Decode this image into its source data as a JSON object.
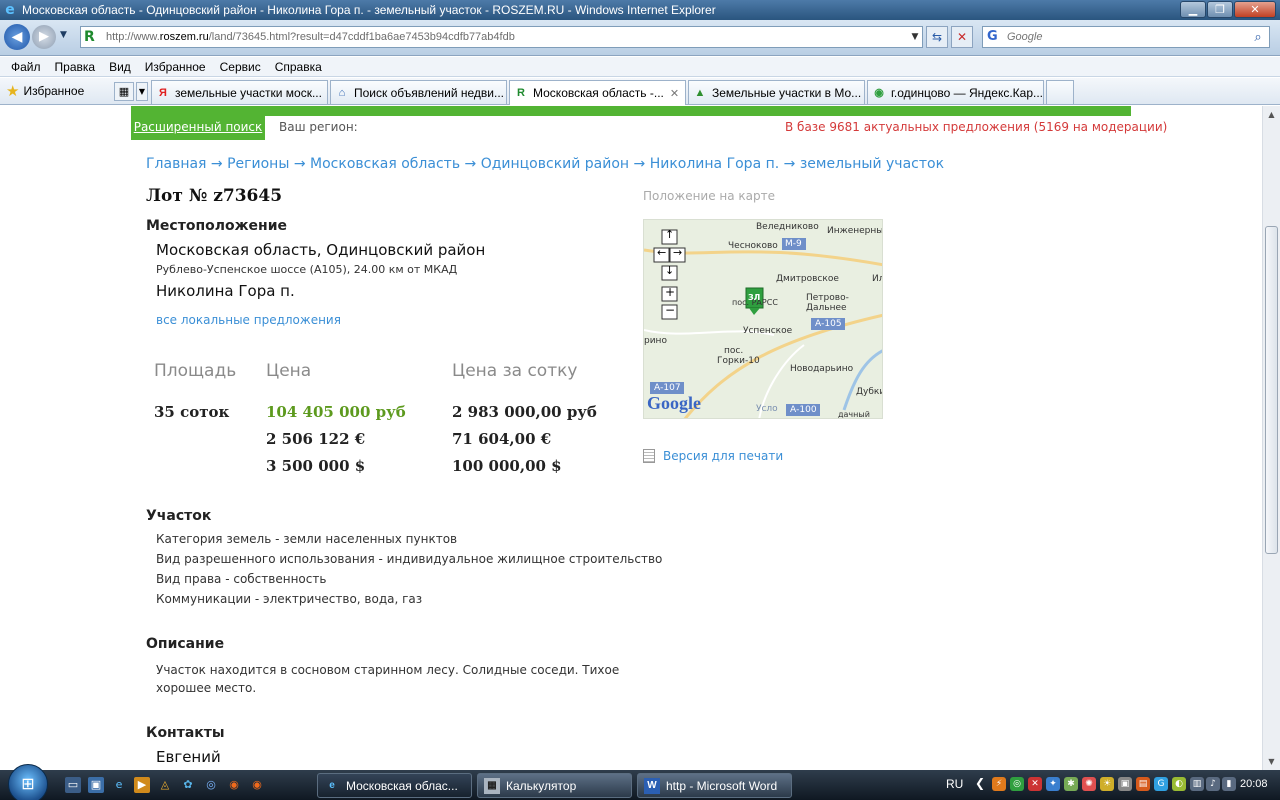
{
  "window": {
    "title": "Московская область - Одинцовский район - Николина Гора п. - земельный участок - ROSZEM.RU - Windows Internet Explorer"
  },
  "address": {
    "url_prefix": "http://www.",
    "url_domain": "roszem.ru",
    "url_rest": "/land/73645.html?result=d47cddf1ba6ae7453b94cdfb77ab4fdb",
    "search_placeholder": "Google"
  },
  "menu": [
    "Файл",
    "Правка",
    "Вид",
    "Избранное",
    "Сервис",
    "Справка"
  ],
  "favorites_label": "Избранное",
  "tabs": [
    {
      "label": "земельные участки моск...",
      "icon": "yandex-icon"
    },
    {
      "label": "Поиск объявлений недви...",
      "icon": "home-icon"
    },
    {
      "label": "Московская область -...",
      "icon": "roszem-icon",
      "active": true
    },
    {
      "label": "Земельные участки в Мо...",
      "icon": "land-icon"
    },
    {
      "label": "г.одинцово — Яндекс.Кар...",
      "icon": "yandex-maps-icon"
    }
  ],
  "page": {
    "advanced_search": "Расширенный поиск",
    "region_label": "Ваш регион:",
    "db_count": "В базе 9681 актуальных предложения (5169 на модерации)",
    "breadcrumb": "Главная → Регионы → Московская область → Одинцовский район → Николина Гора п. → земельный участок",
    "lot_title": "Лот № z73645",
    "location": {
      "heading": "Местоположение",
      "region": "Московская область, Одинцовский район",
      "road": "Рублево-Успенское шоссе (А105), 24.00 км от МКАД",
      "place": "Николина Гора п.",
      "local_link": "все локальные предложения"
    },
    "price": {
      "area_h": "Площадь",
      "price_h": "Цена",
      "per_h": "Цена за сотку",
      "area": "35 соток",
      "rub": "104 405 000 руб",
      "eur": "2 506 122 €",
      "usd": "3 500 000 $",
      "per_rub": "2 983 000,00 руб",
      "per_eur": "71 604,00 €",
      "per_usd": "100 000,00 $"
    },
    "plot": {
      "heading": "Участок",
      "rows": [
        "Категория земель - земли населенных пунктов",
        "Вид разрешенного использования - индивидуальное жилищное строительство",
        "Вид права - собственность",
        "Коммуникации - электричество, вода, газ"
      ]
    },
    "description": {
      "heading": "Описание",
      "text": "Участок находится в сосновом старинном лесу. Солидные соседи. Тихое хорошее место."
    },
    "contacts": {
      "heading": "Контакты",
      "name": "Евгений"
    },
    "map": {
      "label": "Положение на карте",
      "places": [
        "Веледниково",
        "Инженерный",
        "Чесноково",
        "М-9",
        "Дмитровское",
        "Ил",
        "Петрово-Дальнее",
        "пос. РАРСС",
        "Успенское",
        "А-105",
        "рино",
        "пос.",
        "Горки-10",
        "Новодарьино",
        "Дубки",
        "А-107",
        "Усло",
        "А-100",
        "дачный пос"
      ],
      "marker": "ЗЛ",
      "google": "Google"
    },
    "print_link": "Версия для печати"
  },
  "taskbar": {
    "buttons": [
      {
        "label": "Московская облас...",
        "icon": "ie-icon",
        "active": true
      },
      {
        "label": "Калькулятор",
        "icon": "calculator-icon"
      },
      {
        "label": "http - Microsoft Word",
        "icon": "word-icon"
      }
    ],
    "lang": "RU",
    "clock": "20:08"
  },
  "colors": {
    "accent_green": "#53b433",
    "link_blue": "#3b8fd6",
    "alert_red": "#d43a3a",
    "price_green": "#5d9a1e"
  }
}
